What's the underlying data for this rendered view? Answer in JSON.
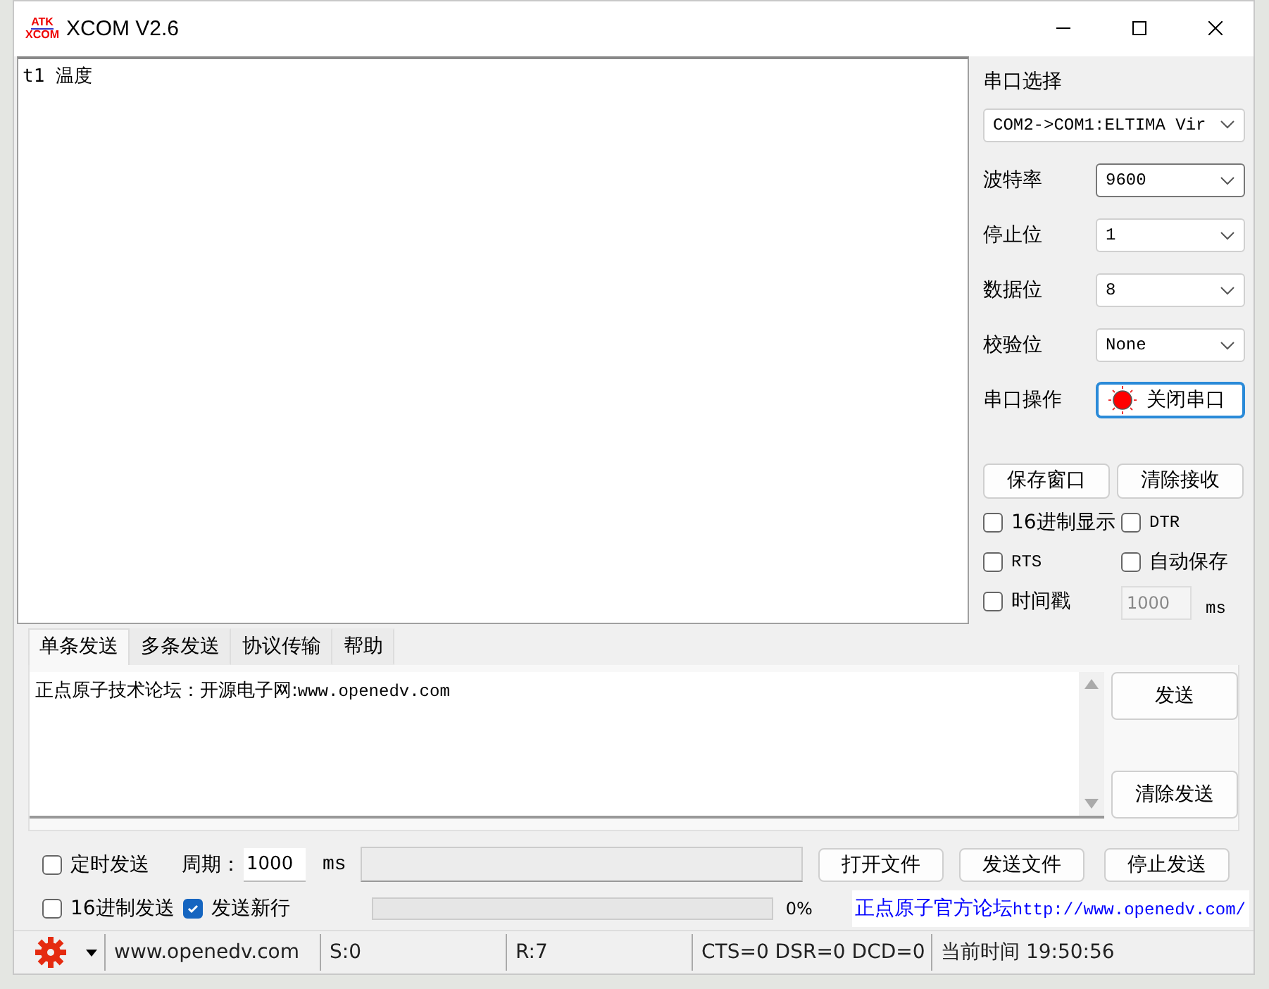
{
  "window": {
    "logo_top": "ATK",
    "logo_bottom": "XCOM",
    "title": "XCOM V2.6"
  },
  "receive": {
    "text": "t1 温度"
  },
  "serial": {
    "port_label": "串口选择",
    "port": "COM2->COM1:ELTIMA Vir",
    "fields": [
      {
        "label": "波特率",
        "value": "9600",
        "focused": true
      },
      {
        "label": "停止位",
        "value": "1",
        "focused": false
      },
      {
        "label": "数据位",
        "value": "8",
        "focused": false
      },
      {
        "label": "校验位",
        "value": "None",
        "focused": false
      }
    ],
    "operation_label": "串口操作",
    "port_button": "关闭串口",
    "port_open": true
  },
  "panel_buttons": [
    "保存窗口",
    "清除接收"
  ],
  "options": [
    {
      "label": "16进制显示",
      "checked": false
    },
    {
      "label": "DTR",
      "checked": false
    },
    {
      "label": "RTS",
      "checked": false
    },
    {
      "label": "自动保存",
      "checked": false
    },
    {
      "label": "时间戳",
      "checked": false
    }
  ],
  "timestamp_interval": {
    "value": "1000",
    "unit": "ms",
    "disabled": true
  },
  "tabs": [
    {
      "label": "单条发送",
      "selected": true
    },
    {
      "label": "多条发送",
      "selected": false
    },
    {
      "label": "协议传输",
      "selected": false
    },
    {
      "label": "帮助",
      "selected": false
    }
  ],
  "send": {
    "text": "正点原子技术论坛：开源电子网:www.openedv.com",
    "buttons": [
      "发送",
      "清除发送"
    ]
  },
  "timed_send": {
    "label": "定时发送",
    "checked": false
  },
  "period": {
    "label": "周期：",
    "value": "1000",
    "unit": "ms"
  },
  "file_buttons": [
    "打开文件",
    "发送文件",
    "停止发送"
  ],
  "hex_send": {
    "label": "16进制发送",
    "checked": false
  },
  "send_newline": {
    "label": "发送新行",
    "checked": true
  },
  "progress": {
    "level": 0,
    "text": "0%"
  },
  "link": "正点原子官方论坛http://www.openedv.com/",
  "status_bar": [
    "www.openedv.com",
    "S:0",
    "R:7",
    "CTS=0 DSR=0 DCD=0",
    "当前时间 19:50:56"
  ]
}
